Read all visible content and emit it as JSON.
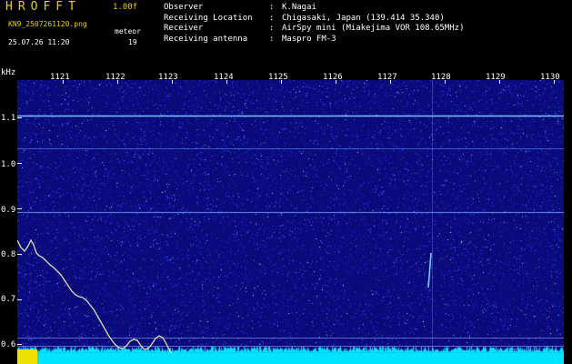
{
  "header": {
    "logo": "HROFFT",
    "version": "1.00f",
    "filename": "KN9_2507261120.png",
    "mode": "meteor",
    "datetime": "25.07.26 11:20",
    "count": "19"
  },
  "info": [
    {
      "label": "Observer",
      "value": "K.Nagai"
    },
    {
      "label": "Receiving Location",
      "value": "Chigasaki, Japan (139.414 35.340)"
    },
    {
      "label": "Receiver",
      "value": "AirSpy mini (Miakejima VOR 108.65MHz)"
    },
    {
      "label": "Receiving antenna",
      "value": "Maspro FM-3"
    }
  ],
  "axes": {
    "y_unit": "kHz",
    "y_ticks": [
      "1.1",
      "1.0",
      "0.9",
      "0.8",
      "0.7",
      "0.6"
    ],
    "y_values": [
      1.1,
      1.0,
      0.9,
      0.8,
      0.7,
      0.6
    ],
    "x_ticks": [
      "1121",
      "1122",
      "1123",
      "1124",
      "1125",
      "1126",
      "1127",
      "1128",
      "1129",
      "1130"
    ]
  },
  "colors": {
    "background": "#000000",
    "plot": "#0a0a7a",
    "logo": "#f0d000",
    "carrier": "#7fdcff",
    "trace": "#e8e8b0",
    "baseline": "#00e5ff"
  }
}
